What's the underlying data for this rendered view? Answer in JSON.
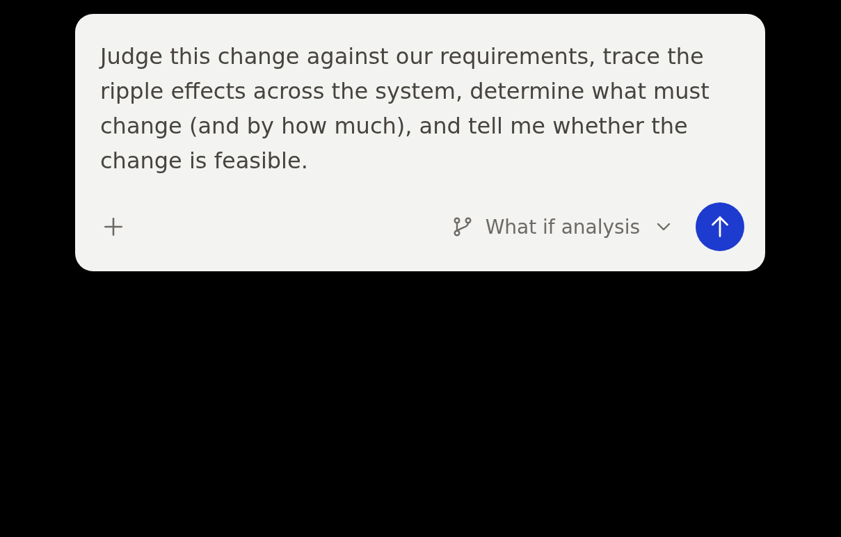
{
  "composer": {
    "value": "Judge this change against our requirements, trace the ripple effects across the system, determine what must change (and by how much), and tell me whether the change is feasible.",
    "mode": {
      "label": "What if analysis"
    }
  }
}
